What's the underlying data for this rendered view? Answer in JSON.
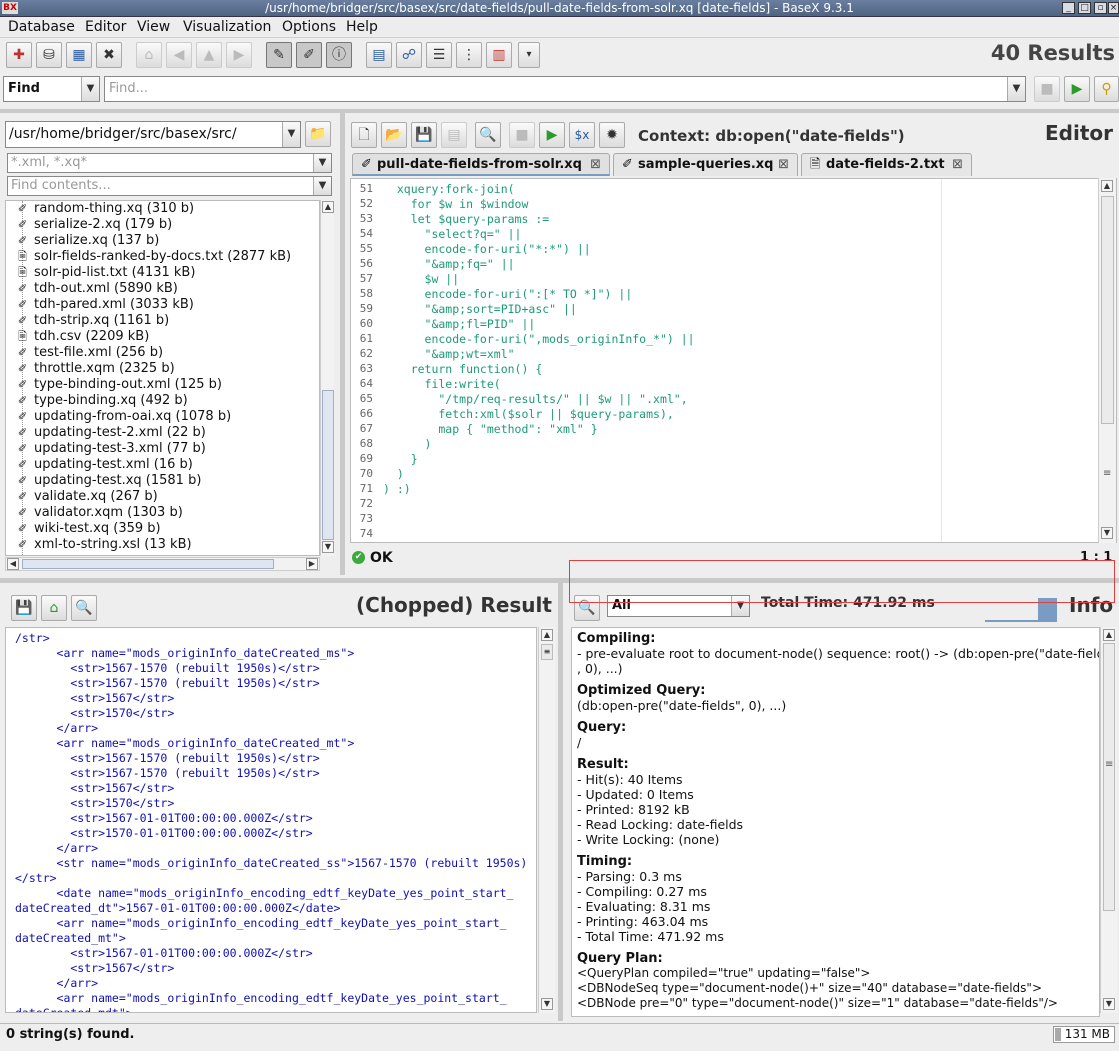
{
  "window": {
    "title": "/usr/home/bridger/src/basex/src/date-fields/pull-date-fields-from-solr.xq [date-fields] - BaseX 9.3.1"
  },
  "menu": [
    "Database",
    "Editor",
    "View",
    "Visualization",
    "Options",
    "Help"
  ],
  "header": {
    "results": "40 Results"
  },
  "find": {
    "mode": "Find",
    "placeholder": "Find..."
  },
  "project": {
    "path": "/usr/home/bridger/src/basex/src/",
    "filter_placeholder": "*.xml, *.xq*",
    "contents_placeholder": "Find contents...",
    "files": [
      {
        "name": "random-thing.xq (310 b)",
        "icon": "xquery-icon"
      },
      {
        "name": "serialize-2.xq (179 b)",
        "icon": "xquery-icon"
      },
      {
        "name": "serialize.xq (137 b)",
        "icon": "xquery-icon"
      },
      {
        "name": "solr-fields-ranked-by-docs.txt (2877 kB)",
        "icon": "text-file-icon"
      },
      {
        "name": "solr-pid-list.txt (4131 kB)",
        "icon": "text-file-icon"
      },
      {
        "name": "tdh-out.xml (5890 kB)",
        "icon": "xml-icon"
      },
      {
        "name": "tdh-pared.xml (3033 kB)",
        "icon": "xml-icon"
      },
      {
        "name": "tdh-strip.xq (1161 b)",
        "icon": "xquery-icon"
      },
      {
        "name": "tdh.csv (2209 kB)",
        "icon": "text-file-icon"
      },
      {
        "name": "test-file.xml (256 b)",
        "icon": "xml-icon"
      },
      {
        "name": "throttle.xqm (2325 b)",
        "icon": "xquery-icon"
      },
      {
        "name": "type-binding-out.xml (125 b)",
        "icon": "xml-icon"
      },
      {
        "name": "type-binding.xq (492 b)",
        "icon": "xquery-icon"
      },
      {
        "name": "updating-from-oai.xq (1078 b)",
        "icon": "xquery-icon"
      },
      {
        "name": "updating-test-2.xml (22 b)",
        "icon": "xml-icon"
      },
      {
        "name": "updating-test-3.xml (77 b)",
        "icon": "xml-icon"
      },
      {
        "name": "updating-test.xml (16 b)",
        "icon": "xml-icon"
      },
      {
        "name": "updating-test.xq (1581 b)",
        "icon": "xquery-icon"
      },
      {
        "name": "validate.xq (267 b)",
        "icon": "xquery-icon"
      },
      {
        "name": "validator.xqm (1303 b)",
        "icon": "xquery-icon"
      },
      {
        "name": "wiki-test.xq (359 b)",
        "icon": "xquery-icon"
      },
      {
        "name": "xml-to-string.xsl (13 kB)",
        "icon": "xml-icon"
      }
    ]
  },
  "editor": {
    "title": "Editor",
    "context": "Context: db:open(\"date-fields\")",
    "tabs": [
      {
        "label": "pull-date-fields-from-solr.xq",
        "active": true
      },
      {
        "label": "sample-queries.xq",
        "active": false
      },
      {
        "label": "date-fields-2.txt",
        "active": false
      }
    ],
    "lines": [
      {
        "n": "51",
        "text": "  xquery:fork-join("
      },
      {
        "n": "52",
        "text": "    for $w in $window"
      },
      {
        "n": "53",
        "text": "    let $query-params :="
      },
      {
        "n": "54",
        "text": "      \"select?q=\" ||"
      },
      {
        "n": "55",
        "text": "      encode-for-uri(\"*:*\") ||"
      },
      {
        "n": "56",
        "text": "      \"&amp;fq=\" ||"
      },
      {
        "n": "57",
        "text": "      $w ||"
      },
      {
        "n": "58",
        "text": "      encode-for-uri(\":[* TO *]\") ||"
      },
      {
        "n": "59",
        "text": "      \"&amp;sort=PID+asc\" ||"
      },
      {
        "n": "60",
        "text": "      \"&amp;fl=PID\" ||"
      },
      {
        "n": "61",
        "text": "      encode-for-uri(\",mods_originInfo_*\") ||"
      },
      {
        "n": "62",
        "text": "      \"&amp;wt=xml\""
      },
      {
        "n": "63",
        "text": "    return function() {"
      },
      {
        "n": "64",
        "text": "      file:write("
      },
      {
        "n": "65",
        "text": "        \"/tmp/req-results/\" || $w || \".xml\","
      },
      {
        "n": "66",
        "text": "        fetch:xml($solr || $query-params),"
      },
      {
        "n": "67",
        "text": "        map { \"method\": \"xml\" }"
      },
      {
        "n": "68",
        "text": "      )"
      },
      {
        "n": "69",
        "text": "    }"
      },
      {
        "n": "70",
        "text": "  )"
      },
      {
        "n": "71",
        "text": ") :)"
      },
      {
        "n": "72",
        "text": ""
      },
      {
        "n": "73",
        "text": ""
      },
      {
        "n": "74",
        "text": ""
      }
    ],
    "status": "OK",
    "position": "1 : 1"
  },
  "result": {
    "title": "(Chopped) Result",
    "lines": [
      "/str>",
      "      <arr name=\"mods_originInfo_dateCreated_ms\">",
      "        <str>1567-1570 (rebuilt 1950s)</str>",
      "        <str>1567-1570 (rebuilt 1950s)</str>",
      "        <str>1567</str>",
      "        <str>1570</str>",
      "      </arr>",
      "      <arr name=\"mods_originInfo_dateCreated_mt\">",
      "        <str>1567-1570 (rebuilt 1950s)</str>",
      "        <str>1567-1570 (rebuilt 1950s)</str>",
      "        <str>1567</str>",
      "        <str>1570</str>",
      "        <str>1567-01-01T00:00:00.000Z</str>",
      "        <str>1570-01-01T00:00:00.000Z</str>",
      "      </arr>",
      "      <str name=\"mods_originInfo_dateCreated_ss\">1567-1570 (rebuilt 1950s)",
      "</str>",
      "      <date name=\"mods_originInfo_encoding_edtf_keyDate_yes_point_start_",
      "dateCreated_dt\">1567-01-01T00:00:00.000Z</date>",
      "      <arr name=\"mods_originInfo_encoding_edtf_keyDate_yes_point_start_",
      "dateCreated_mt\">",
      "        <str>1567-01-01T00:00:00.000Z</str>",
      "        <str>1567</str>",
      "      </arr>",
      "      <arr name=\"mods_originInfo_encoding_edtf_keyDate_yes_point_start_",
      "dateCreated_mdt\">"
    ]
  },
  "info": {
    "title": "Info",
    "mode": "All",
    "total_time": "Total Time: 471.92 ms",
    "sections": [
      {
        "heading": "Compiling:",
        "lines": [
          "- pre-evaluate root to document-node() sequence: root() -> (db:open-pre(\"date-fields\"",
          ", 0), ...)"
        ]
      },
      {
        "heading": "Optimized Query:",
        "lines": [
          "(db:open-pre(\"date-fields\", 0), ...)"
        ]
      },
      {
        "heading": "Query:",
        "lines": [
          "/"
        ]
      },
      {
        "heading": "Result:",
        "lines": [
          "- Hit(s): 40 Items",
          "- Updated: 0 Items",
          "- Printed: 8192 kB",
          "- Read Locking: date-fields",
          "- Write Locking: (none)"
        ]
      },
      {
        "heading": "Timing:",
        "lines": [
          "- Parsing: 0.3 ms",
          "- Compiling: 0.27 ms",
          "- Evaluating: 8.31 ms",
          "- Printing: 463.04 ms",
          "- Total Time: 471.92 ms"
        ]
      },
      {
        "heading": "Query Plan:",
        "lines": [
          "<QueryPlan compiled=\"true\" updating=\"false\">",
          "  <DBNodeSeq type=\"document-node()+\" size=\"40\" database=\"date-fields\">",
          "    <DBNode pre=\"0\" type=\"document-node()\" size=\"1\" database=\"date-fields\"/>"
        ]
      }
    ]
  },
  "status": {
    "message": "0 string(s) found.",
    "memory": "131 MB"
  }
}
